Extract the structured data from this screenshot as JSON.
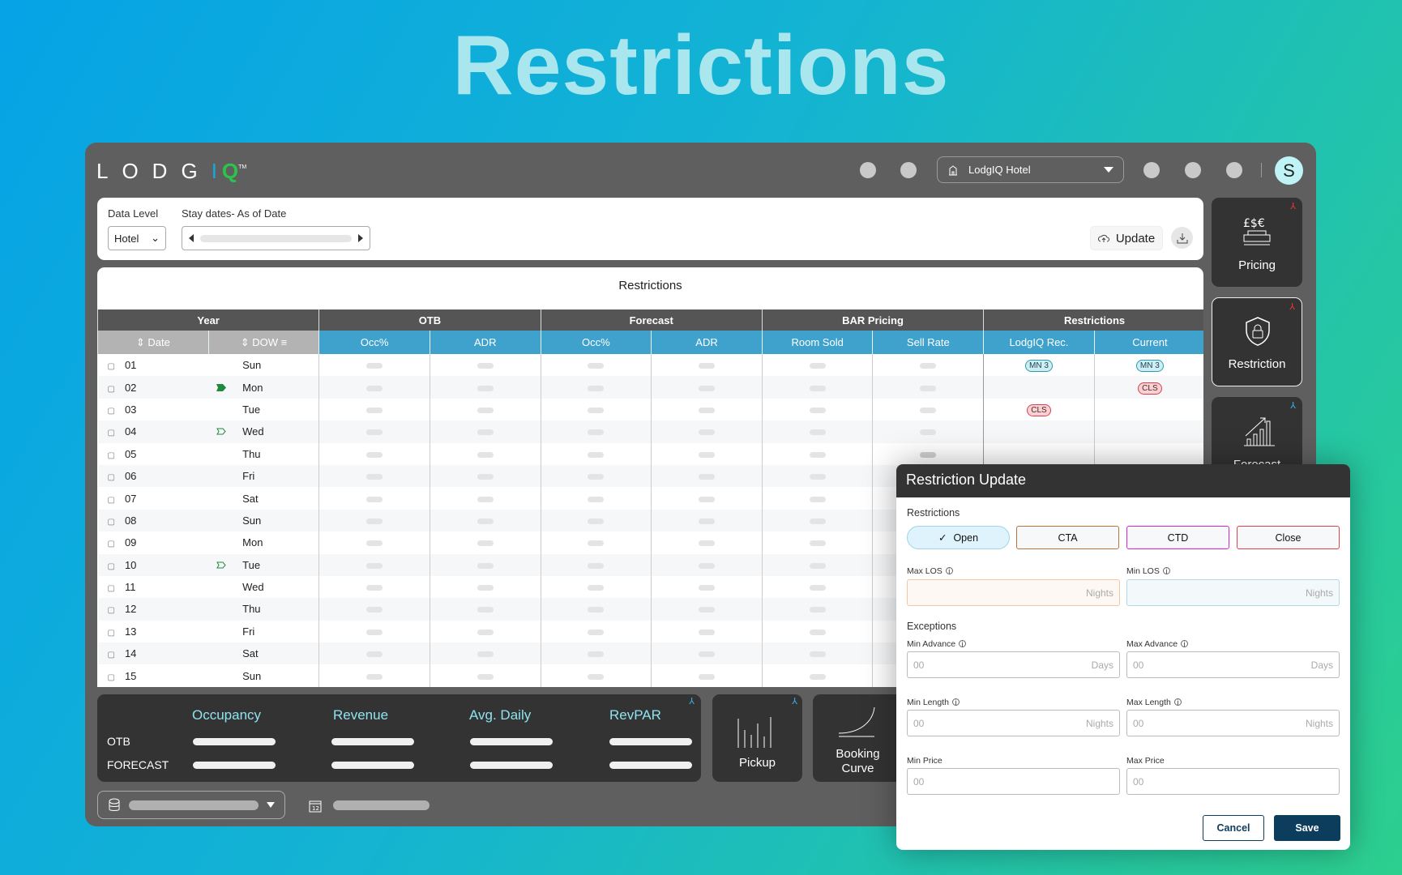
{
  "hero_title": "Restrictions",
  "app": {
    "logo": {
      "text": "LODG",
      "bar": "I",
      "q": "Q",
      "tm": "TM"
    },
    "hotel_select": "LodgIQ Hotel",
    "avatar": "S"
  },
  "filters": {
    "data_level_label": "Data Level",
    "data_level_value": "Hotel",
    "stay_dates_label": "Stay dates- As of Date",
    "update": "Update"
  },
  "table": {
    "title": "Restrictions",
    "groups": [
      "Year",
      "OTB",
      "Forecast",
      "BAR Pricing",
      "Restrictions"
    ],
    "columns": [
      "Date",
      "DOW",
      "Occ%",
      "ADR",
      "Occ%",
      "ADR",
      "Room Sold",
      "Sell Rate",
      "LodgIQ Rec.",
      "Current"
    ],
    "rows": [
      {
        "date": "01",
        "dow": "Sun",
        "flag": "",
        "rec": "MN 3",
        "cur": "MN 3"
      },
      {
        "date": "02",
        "dow": "Mon",
        "flag": "filled",
        "rec": "",
        "cur": "CLS"
      },
      {
        "date": "03",
        "dow": "Tue",
        "flag": "",
        "rec": "CLS",
        "cur": ""
      },
      {
        "date": "04",
        "dow": "Wed",
        "flag": "outline",
        "rec": "",
        "cur": ""
      },
      {
        "date": "05",
        "dow": "Thu",
        "flag": "",
        "rec": "",
        "cur": ""
      },
      {
        "date": "06",
        "dow": "Fri",
        "flag": "",
        "rec": "",
        "cur": ""
      },
      {
        "date": "07",
        "dow": "Sat",
        "flag": "",
        "rec": "",
        "cur": ""
      },
      {
        "date": "08",
        "dow": "Sun",
        "flag": "",
        "rec": "",
        "cur": ""
      },
      {
        "date": "09",
        "dow": "Mon",
        "flag": "",
        "rec": "",
        "cur": ""
      },
      {
        "date": "10",
        "dow": "Tue",
        "flag": "outline",
        "rec": "",
        "cur": ""
      },
      {
        "date": "11",
        "dow": "Wed",
        "flag": "",
        "rec": "",
        "cur": ""
      },
      {
        "date": "12",
        "dow": "Thu",
        "flag": "",
        "rec": "",
        "cur": ""
      },
      {
        "date": "13",
        "dow": "Fri",
        "flag": "",
        "rec": "",
        "cur": ""
      },
      {
        "date": "14",
        "dow": "Sat",
        "flag": "",
        "rec": "",
        "cur": ""
      },
      {
        "date": "15",
        "dow": "Sun",
        "flag": "",
        "rec": "",
        "cur": ""
      }
    ]
  },
  "side_panels": [
    {
      "label": "Pricing"
    },
    {
      "label": "Restriction"
    },
    {
      "label": "Forecast"
    }
  ],
  "kpi": {
    "headers": [
      "Occupancy",
      "Revenue",
      "Avg. Daily",
      "RevPAR"
    ],
    "rows": [
      "OTB",
      "FORECAST"
    ]
  },
  "mini_panels": {
    "pickup": "Pickup",
    "booking_curve_1": "Booking",
    "booking_curve_2": "Curve"
  },
  "modal": {
    "title": "Restriction Update",
    "restrictions_label": "Restrictions",
    "buttons": [
      "Open",
      "CTA",
      "CTD",
      "Close"
    ],
    "max_los": "Max LOS",
    "min_los": "Min LOS",
    "nights": "Nights",
    "days": "Days",
    "exceptions": "Exceptions",
    "min_advance": "Min Advance",
    "max_advance": "Max Advance",
    "min_length": "Min Length",
    "max_length": "Max Length",
    "min_price": "Min Price",
    "max_price": "Max Price",
    "placeholder": "00",
    "cancel": "Cancel",
    "save": "Save"
  },
  "colors": {
    "accent": "#3ea2cd",
    "save": "#0d3d5c",
    "cta": "#b8743a",
    "ctd": "#e020d8",
    "close": "#e0404c"
  }
}
